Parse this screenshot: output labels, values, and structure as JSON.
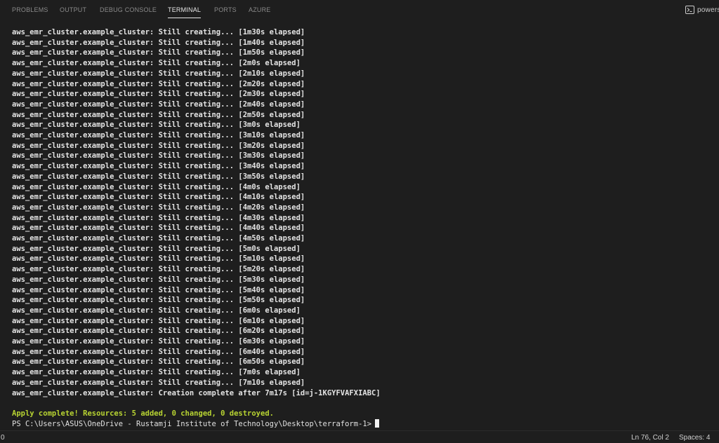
{
  "panel": {
    "tabs": [
      {
        "label": "PROBLEMS",
        "active": false
      },
      {
        "label": "OUTPUT",
        "active": false
      },
      {
        "label": "DEBUG CONSOLE",
        "active": false
      },
      {
        "label": "TERMINAL",
        "active": true
      },
      {
        "label": "PORTS",
        "active": false
      },
      {
        "label": "AZURE",
        "active": false
      }
    ],
    "shell_label": "powers",
    "shell_icon": "terminal-powershell-icon"
  },
  "terminal": {
    "lines": [
      "aws_emr_cluster.example_cluster: Still creating... [1m30s elapsed]",
      "aws_emr_cluster.example_cluster: Still creating... [1m40s elapsed]",
      "aws_emr_cluster.example_cluster: Still creating... [1m50s elapsed]",
      "aws_emr_cluster.example_cluster: Still creating... [2m0s elapsed]",
      "aws_emr_cluster.example_cluster: Still creating... [2m10s elapsed]",
      "aws_emr_cluster.example_cluster: Still creating... [2m20s elapsed]",
      "aws_emr_cluster.example_cluster: Still creating... [2m30s elapsed]",
      "aws_emr_cluster.example_cluster: Still creating... [2m40s elapsed]",
      "aws_emr_cluster.example_cluster: Still creating... [2m50s elapsed]",
      "aws_emr_cluster.example_cluster: Still creating... [3m0s elapsed]",
      "aws_emr_cluster.example_cluster: Still creating... [3m10s elapsed]",
      "aws_emr_cluster.example_cluster: Still creating... [3m20s elapsed]",
      "aws_emr_cluster.example_cluster: Still creating... [3m30s elapsed]",
      "aws_emr_cluster.example_cluster: Still creating... [3m40s elapsed]",
      "aws_emr_cluster.example_cluster: Still creating... [3m50s elapsed]",
      "aws_emr_cluster.example_cluster: Still creating... [4m0s elapsed]",
      "aws_emr_cluster.example_cluster: Still creating... [4m10s elapsed]",
      "aws_emr_cluster.example_cluster: Still creating... [4m20s elapsed]",
      "aws_emr_cluster.example_cluster: Still creating... [4m30s elapsed]",
      "aws_emr_cluster.example_cluster: Still creating... [4m40s elapsed]",
      "aws_emr_cluster.example_cluster: Still creating... [4m50s elapsed]",
      "aws_emr_cluster.example_cluster: Still creating... [5m0s elapsed]",
      "aws_emr_cluster.example_cluster: Still creating... [5m10s elapsed]",
      "aws_emr_cluster.example_cluster: Still creating... [5m20s elapsed]",
      "aws_emr_cluster.example_cluster: Still creating... [5m30s elapsed]",
      "aws_emr_cluster.example_cluster: Still creating... [5m40s elapsed]",
      "aws_emr_cluster.example_cluster: Still creating... [5m50s elapsed]",
      "aws_emr_cluster.example_cluster: Still creating... [6m0s elapsed]",
      "aws_emr_cluster.example_cluster: Still creating... [6m10s elapsed]",
      "aws_emr_cluster.example_cluster: Still creating... [6m20s elapsed]",
      "aws_emr_cluster.example_cluster: Still creating... [6m30s elapsed]",
      "aws_emr_cluster.example_cluster: Still creating... [6m40s elapsed]",
      "aws_emr_cluster.example_cluster: Still creating... [6m50s elapsed]",
      "aws_emr_cluster.example_cluster: Still creating... [7m0s elapsed]",
      "aws_emr_cluster.example_cluster: Still creating... [7m10s elapsed]",
      "aws_emr_cluster.example_cluster: Creation complete after 7m17s [id=j-1KGYFVAFXIABC]",
      "",
      "Apply complete! Resources: 5 added, 0 changed, 0 destroyed."
    ],
    "success_color": "#b8d432",
    "prompt": "PS C:\\Users\\ASUS\\OneDrive - Rustamji Institute of Technology\\Desktop\\terraform-1>"
  },
  "statusbar": {
    "left_count": "0",
    "cursor_position": "Ln 76, Col 2",
    "indentation": "Spaces: 4"
  }
}
